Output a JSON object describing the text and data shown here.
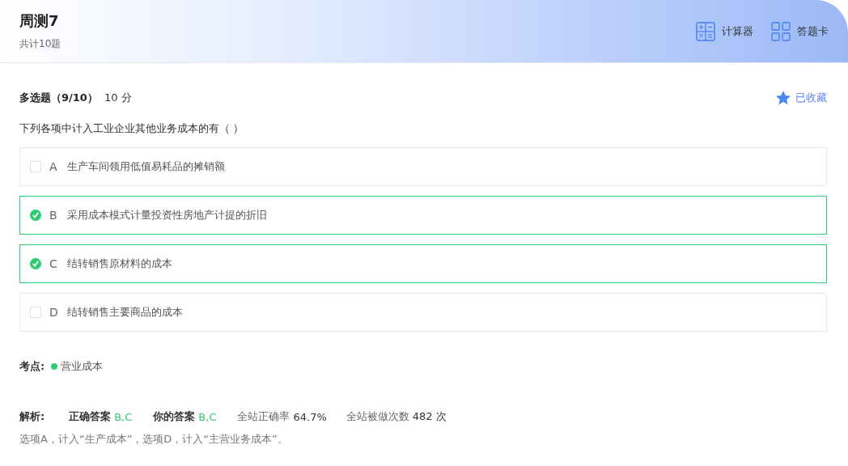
{
  "header": {
    "title": "周测7",
    "subtitle": "共计10题",
    "tools": [
      {
        "kind": "calculator",
        "label": "计算器"
      },
      {
        "kind": "answer_card",
        "label": "答题卡"
      }
    ]
  },
  "question": {
    "type_label": "多选题（9/10）",
    "score": "10 分",
    "favorite": {
      "label": "已收藏",
      "on": true
    },
    "stem": "下列各项中计入工业企业其他业务成本的有（  ）",
    "options": [
      {
        "letter": "A",
        "text": "生产车间领用低值易耗品的摊销额",
        "checked": false
      },
      {
        "letter": "B",
        "text": "采用成本模式计量投资性房地产计提的折旧",
        "checked": true
      },
      {
        "letter": "C",
        "text": "结转销售原材料的成本",
        "checked": true
      },
      {
        "letter": "D",
        "text": "结转销售主要商品的成本",
        "checked": false
      }
    ]
  },
  "knowledge": {
    "label": "考点:",
    "tags": [
      {
        "text": "营业成本",
        "color": "#2ecc71"
      }
    ]
  },
  "analysis": {
    "label": "解析:",
    "correct": {
      "label": "正确答案",
      "value": "B,C"
    },
    "yours": {
      "label": "你的答案",
      "value": "B,C"
    },
    "rate": {
      "label": "全站正确率",
      "value": "64.7%"
    },
    "count": {
      "label": "全站被做次数",
      "value": "482 次"
    },
    "text": "选项A，计入“生产成本”，选项D，计入“主营业务成本”。"
  }
}
